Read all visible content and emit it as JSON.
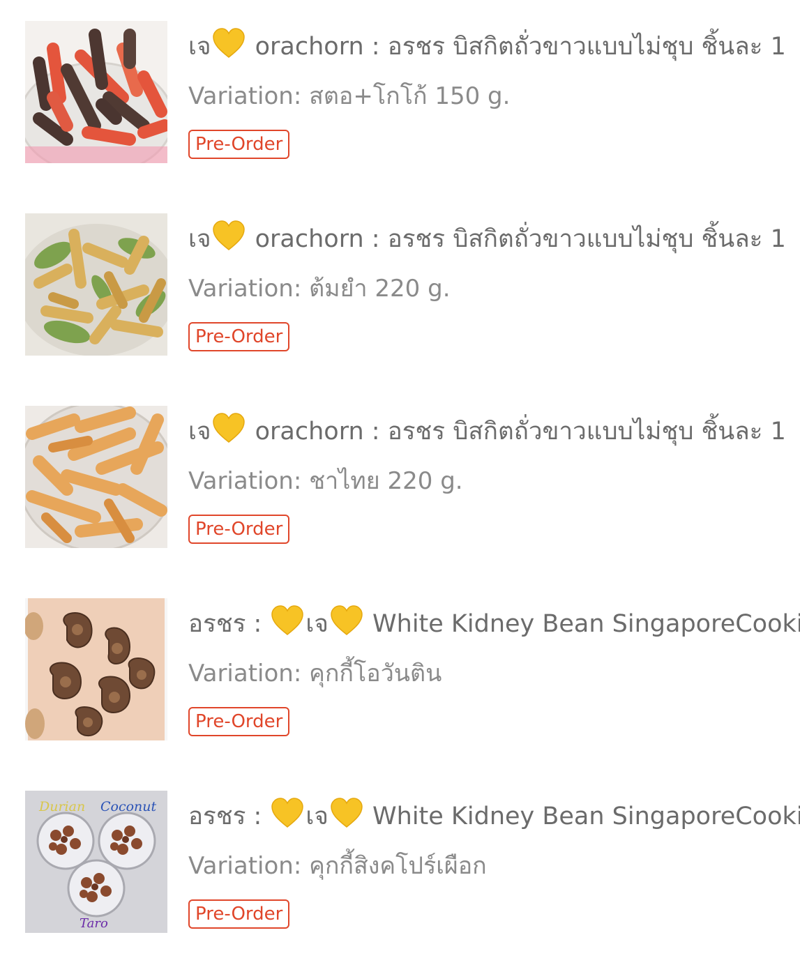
{
  "items": [
    {
      "title_prefix": "เจ",
      "title_mid": "",
      "title_rest": " orachorn : อรชร บิสกิตถั่วขาวแบบไม่ชุบ ชิ้นละ 1",
      "hearts": 1,
      "variation": "Variation: สตอ+โกโก้ 150 g.",
      "badge": "Pre-Order",
      "image": "strawberry-cocoa-biscuit-sticks"
    },
    {
      "title_prefix": "เจ",
      "title_mid": "",
      "title_rest": " orachorn : อรชร บิสกิตถั่วขาวแบบไม่ชุบ ชิ้นละ 1",
      "hearts": 1,
      "variation": "Variation: ต้มยำ 220 g.",
      "badge": "Pre-Order",
      "image": "tom-yum-biscuit-sticks"
    },
    {
      "title_prefix": "เจ",
      "title_mid": "",
      "title_rest": " orachorn : อรชร บิสกิตถั่วขาวแบบไม่ชุบ ชิ้นละ 1",
      "hearts": 1,
      "variation": "Variation: ชาไทย 220 g.",
      "badge": "Pre-Order",
      "image": "thai-tea-biscuit-sticks"
    },
    {
      "title_prefix": "อรชร : ",
      "title_mid": "เจ",
      "title_rest": " White Kidney Bean SingaporeCookie",
      "hearts": 2,
      "variation": "Variation: คุกกี้โอวันติน",
      "badge": "Pre-Order",
      "image": "ovaltine-cashew-cookies"
    },
    {
      "title_prefix": "อรชร : ",
      "title_mid": "เจ",
      "title_rest": " White Kidney Bean SingaporeCookie",
      "hearts": 2,
      "variation": "Variation: คุกกี้สิงคโปร์เผือก",
      "badge": "Pre-Order",
      "image": "singapore-cookie-cups",
      "image_labels": [
        "Durian",
        "Coconut",
        "Taro"
      ]
    }
  ],
  "colors": {
    "text": "#6b6b6b",
    "variation": "#8a8a8a",
    "badge": "#e0462a",
    "heart": "#f7c325"
  }
}
